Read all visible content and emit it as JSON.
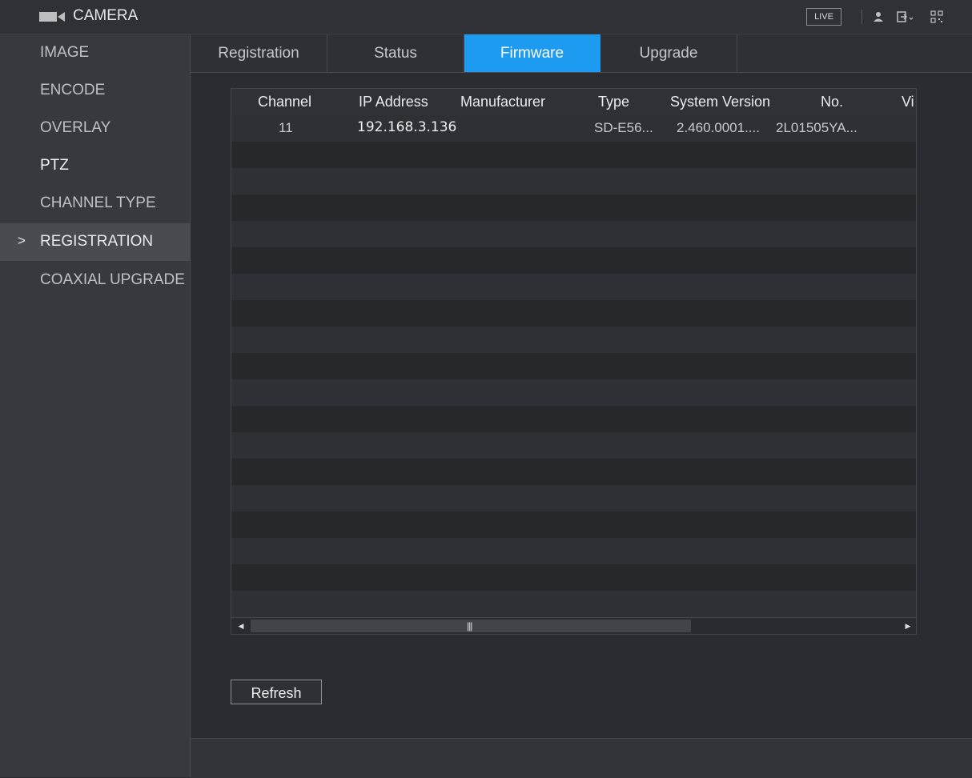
{
  "header": {
    "title": "CAMERA",
    "live_label": "LIVE",
    "icons": [
      "camera-icon",
      "user-icon",
      "logout-icon",
      "qr-code-icon"
    ]
  },
  "sidebar": {
    "items": [
      {
        "label": "IMAGE"
      },
      {
        "label": "ENCODE"
      },
      {
        "label": "OVERLAY"
      },
      {
        "label": "PTZ"
      },
      {
        "label": "CHANNEL TYPE"
      },
      {
        "label": "REGISTRATION",
        "active": true,
        "marker": ">"
      },
      {
        "label": "COAXIAL UPGRADE"
      }
    ]
  },
  "tabs": [
    {
      "label": "Registration"
    },
    {
      "label": "Status"
    },
    {
      "label": "Firmware",
      "active": true
    },
    {
      "label": "Upgrade"
    }
  ],
  "table": {
    "columns": [
      "Channel",
      "IP Address",
      "Manufacturer",
      "Type",
      "System Version",
      "No.",
      "Vi"
    ],
    "rows": [
      {
        "channel": "11",
        "ip": "192.168.3.136",
        "manufacturer": "",
        "type": "SD-E56...",
        "system_version": "2.460.0001....",
        "no": "2L01505YA..."
      }
    ]
  },
  "actions": {
    "refresh_label": "Refresh"
  },
  "colors": {
    "accent": "#1d9bf0",
    "background": "#2b2c31",
    "sidebar": "#38393e"
  }
}
